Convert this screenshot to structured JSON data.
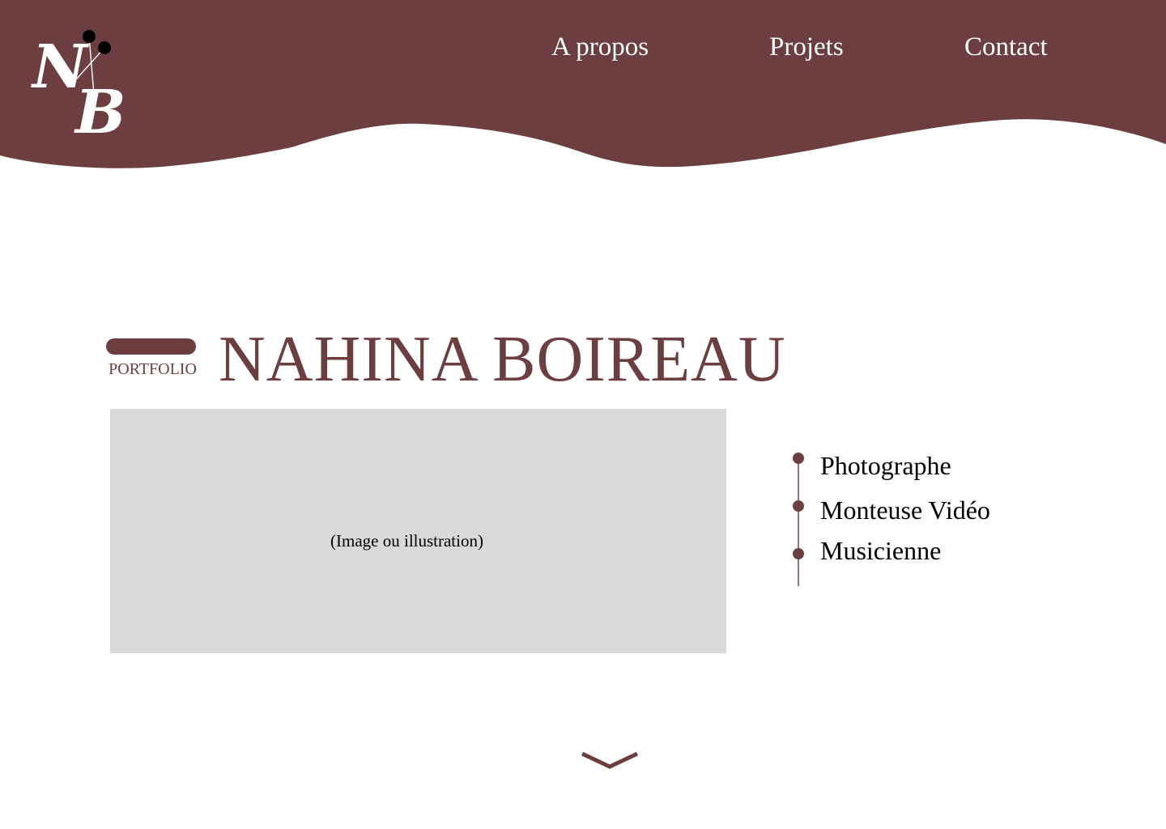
{
  "brand": {
    "logo_text": "NB",
    "colors": {
      "primary": "#6c3e3f",
      "background": "#ffffff",
      "placeholder": "#d9d9d9"
    }
  },
  "nav": {
    "about": "A propos",
    "projects": "Projets",
    "contact": "Contact"
  },
  "hero": {
    "label": "PORTFOLIO",
    "title": "NAHINA BOIREAU",
    "image_caption": "(Image ou illustration)"
  },
  "roles": [
    "Photographe",
    "Monteuse Vidéo",
    "Musicienne"
  ],
  "scroll": {
    "icon": "chevron-down-icon"
  }
}
